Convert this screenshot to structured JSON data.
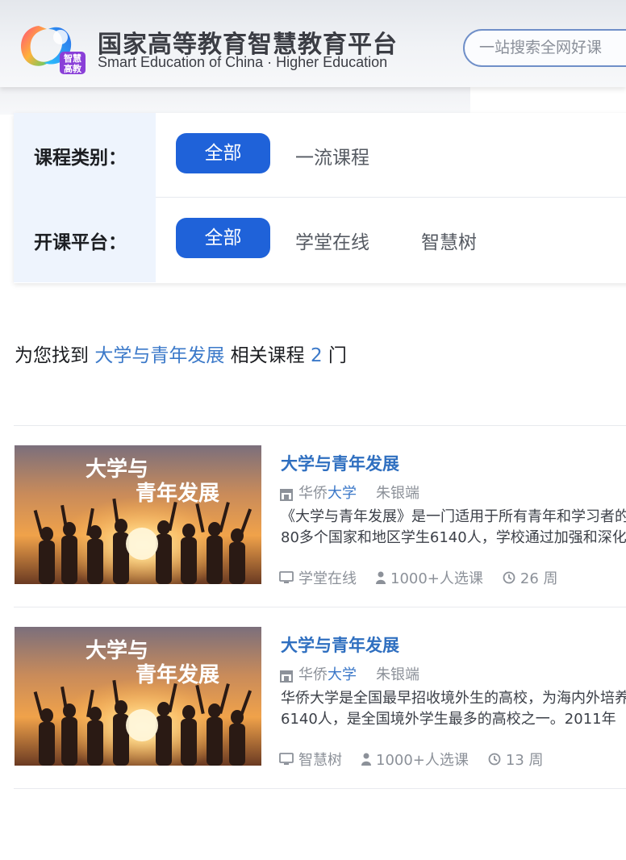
{
  "header": {
    "brand_cn": "国家高等教育智慧教育平台",
    "brand_en": "Smart Education of China · Higher Education",
    "logo_badge_text": "智慧高教",
    "search_placeholder": "一站搜索全网好课"
  },
  "filters": {
    "category": {
      "label": "课程类别：",
      "active": "全部",
      "options": [
        "一流课程"
      ]
    },
    "platform": {
      "label": "开课平台：",
      "active": "全部",
      "options": [
        "学堂在线",
        "智慧树"
      ]
    }
  },
  "summary": {
    "prefix": "为您找到",
    "keyword": "大学与青年发展",
    "middle": "相关课程",
    "count": "2",
    "suffix": "门"
  },
  "courses": [
    {
      "thumb_text_1": "大学与",
      "thumb_text_2": "青年发展",
      "title": "大学与青年发展",
      "university_part1": "华侨",
      "university_part2": "大学",
      "teacher": "朱银端",
      "desc_line1": "《大学与青年发展》是一门适用于所有青年和学习者的课程，学校已培养",
      "desc_line2": "80多个国家和地区学生6140人，学校通过加强和深化",
      "platform": "学堂在线",
      "enrolled": "1000+人选课",
      "weeks": "26 周"
    },
    {
      "thumb_text_1": "大学与",
      "thumb_text_2": "青年发展",
      "title": "大学与青年发展",
      "university_part1": "华侨",
      "university_part2": "大学",
      "teacher": "朱银端",
      "desc_line1": "华侨大学是全国最早招收境外生的高校，为海内外培养各类人才",
      "desc_line2": "6140人，是全国境外学生最多的高校之一。2011年",
      "platform": "智慧树",
      "enrolled": "1000+人选课",
      "weeks": "13 周"
    }
  ],
  "colors": {
    "accent": "#1f62d9",
    "link": "#2f6fc0",
    "label_bg": "#eef4fd"
  }
}
